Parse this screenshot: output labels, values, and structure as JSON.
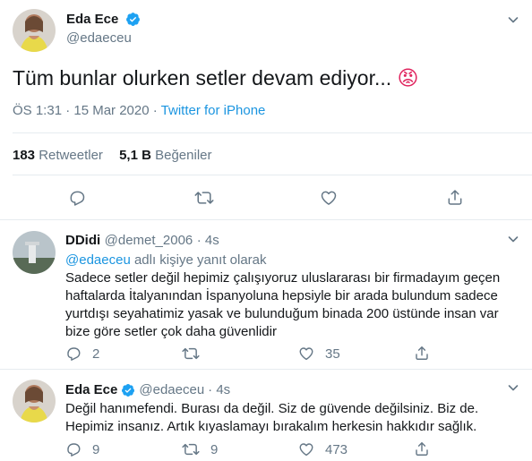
{
  "main_tweet": {
    "author_name": "Eda Ece",
    "handle": "@edaeceu",
    "text": "Tüm bunlar olurken setler devam ediyor...",
    "emoji": "😡",
    "timestamp": "ÖS 1:31 · 15 Mar 2020 · ",
    "source": "Twitter for iPhone",
    "retweet_count": "183",
    "retweet_label": "Retweetler",
    "like_count": "5,1 B",
    "like_label": "Beğeniler",
    "actions": [
      "reply-icon",
      "retweet-icon",
      "like-icon",
      "share-icon"
    ]
  },
  "replies": [
    {
      "author_name": "DDidi",
      "handle": "@demet_2006",
      "time": "· 4s",
      "reply_to_prefix": "",
      "reply_to_handle": "@edaeceu",
      "reply_to_suffix": " adlı kişiye yanıt olarak",
      "lines": [
        "Sadece setler değil hepimiz çalışıyoruz uluslararası bir firmadayım geçen",
        "haftalarda İtalyanından İspanyoluna hepsiyle bir arada bulundum sadece",
        "yurtdışı seyahatimiz yasak ve bulunduğum binada 200 üstünde insan var",
        "bize göre setler çok daha güvenlidir"
      ],
      "reply_count": "2",
      "retweet_count": "",
      "like_count": "35"
    },
    {
      "author_name": "Eda Ece",
      "handle": "@edaeceu",
      "time": "· 4s",
      "lines": [
        "Değil hanımefendi. Burası da değil. Siz de güvende değilsiniz. Biz de.",
        "Hepimiz insanız. Artık kıyaslamayı bırakalım herkesin hakkıdır sağlık."
      ],
      "reply_count": "9",
      "retweet_count": "9",
      "like_count": "473"
    }
  ],
  "colors": {
    "accent": "#1b95e0",
    "text": "#14171a",
    "muted": "#657786",
    "divider": "#e6ecf0",
    "verified": "#1da1f2"
  }
}
